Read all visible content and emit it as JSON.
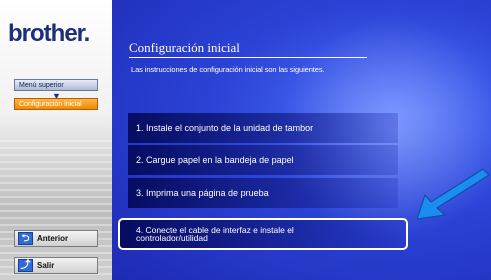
{
  "sidebar": {
    "logo_text": "brother.",
    "menu_superior": "Menú superior",
    "config_inicial": "Configuración inicial",
    "back_label": "Anterior",
    "exit_label": "Salir"
  },
  "main": {
    "title": "Configuración inicial",
    "subtitle": "Las instrucciones de configuración inicial son las siguientes.",
    "steps": [
      "1. Instale el conjunto de la unidad de tambor",
      "2. Cargue papel en la bandeja de papel",
      "3. Imprima una página de prueba",
      "4. Conecte el cable de interfaz e instale el controlador/utilidad"
    ]
  },
  "icons": {
    "down_arrow": "arrow-down-icon",
    "back": "back-arrow-icon",
    "exit": "exit-icon",
    "pointer": "pointer-arrow-icon"
  },
  "colors": {
    "brand": "#1e2f7a",
    "accent": "#f08a00",
    "background": "#2b43d6"
  }
}
